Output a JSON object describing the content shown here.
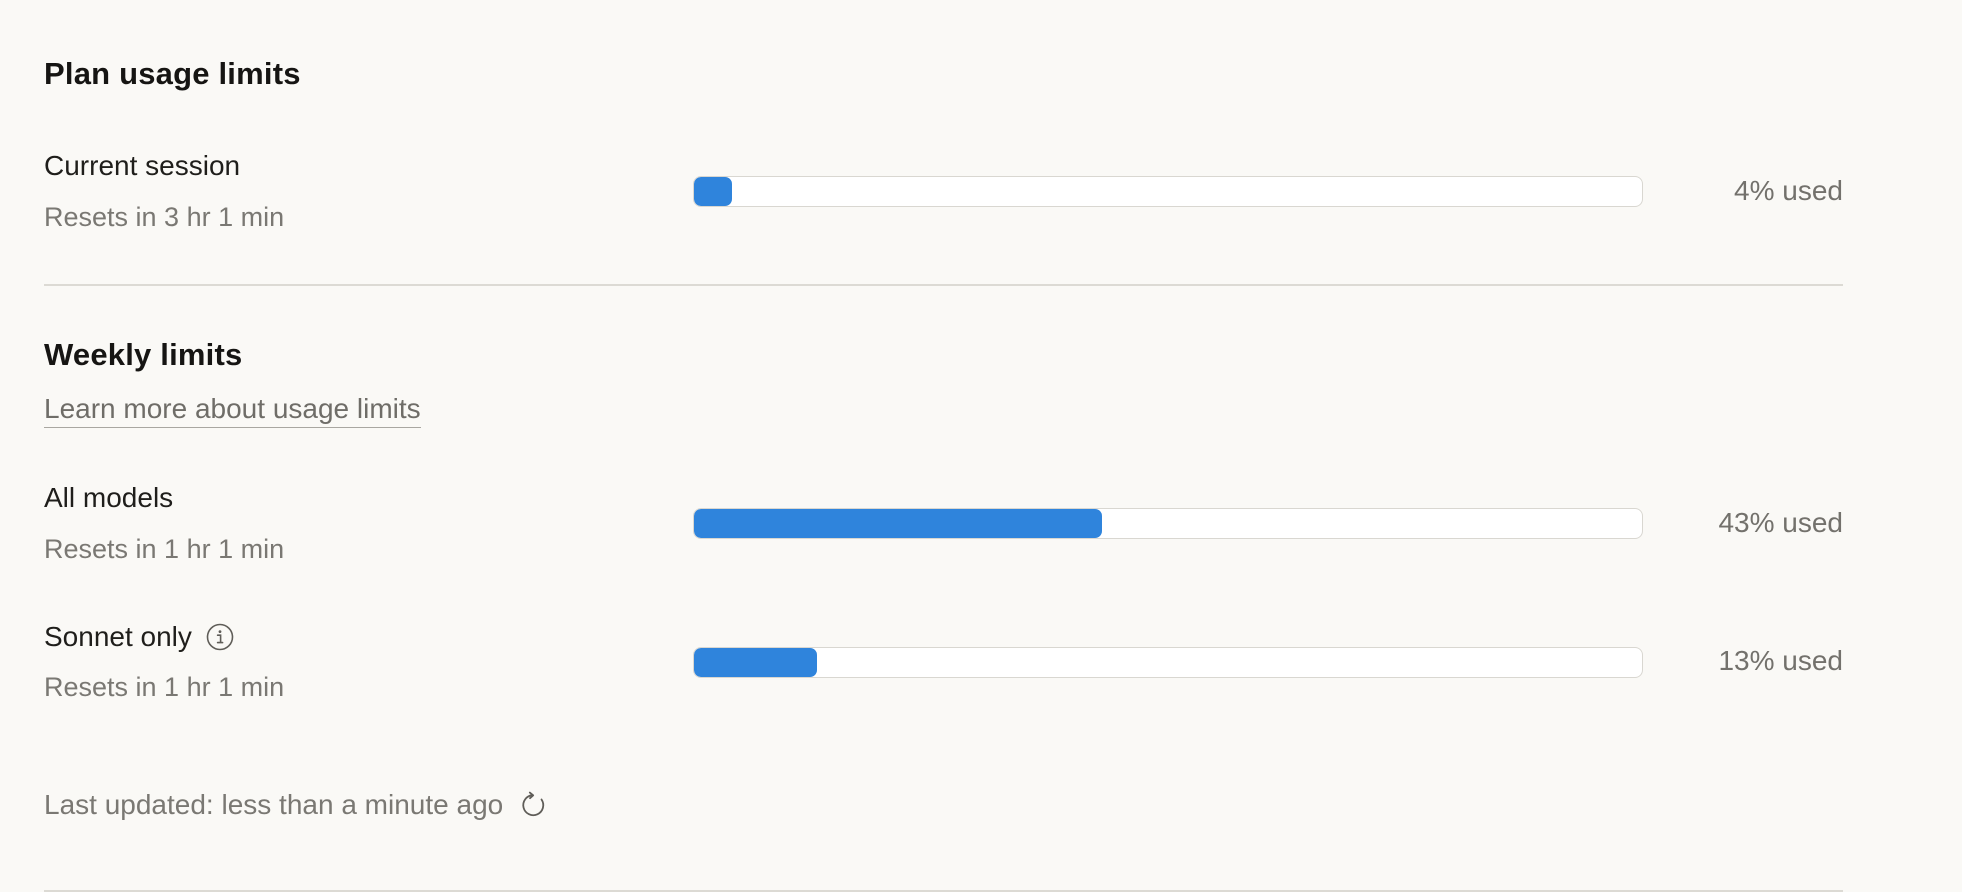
{
  "plan": {
    "title": "Plan usage limits",
    "current_session": {
      "label": "Current session",
      "resets": "Resets in 3 hr 1 min",
      "percent_used": 4,
      "used_text": "4% used"
    }
  },
  "weekly": {
    "title": "Weekly limits",
    "learn_more": "Learn more about usage limits",
    "all_models": {
      "label": "All models",
      "resets": "Resets in 1 hr 1 min",
      "percent_used": 43,
      "used_text": "43% used"
    },
    "sonnet_only": {
      "label": "Sonnet only",
      "resets": "Resets in 1 hr 1 min",
      "percent_used": 13,
      "used_text": "13% used",
      "info_icon": "info-icon"
    }
  },
  "footer": {
    "last_updated": "Last updated: less than a minute ago",
    "refresh_icon": "refresh-icon"
  },
  "colors": {
    "bar_fill": "#2f84dc",
    "background": "#faf9f6"
  }
}
